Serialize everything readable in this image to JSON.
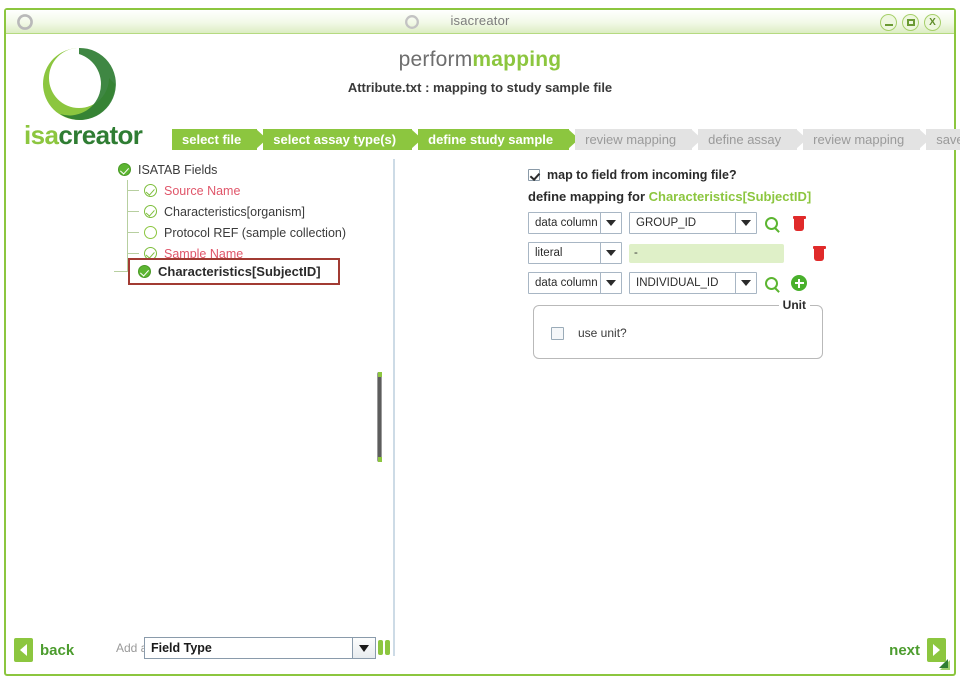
{
  "window": {
    "title": "isacreator",
    "controls": {
      "minimize": "minimize-button",
      "maximize": "maximize-button",
      "close": "X"
    }
  },
  "brand": {
    "logo_icon": "isacreator-ring-logo",
    "word_first": "isa",
    "word_second": "creator"
  },
  "header": {
    "title_prefix": "perform",
    "title_suffix": "mapping",
    "subtitle": "Attribute.txt : mapping to study sample file"
  },
  "breadcrumb": {
    "steps": [
      {
        "label": "select file",
        "state": "active"
      },
      {
        "label": "select assay type(s)",
        "state": "active"
      },
      {
        "label": "define study sample",
        "state": "active"
      },
      {
        "label": "review mapping",
        "state": "inactive"
      },
      {
        "label": "define assay",
        "state": "inactive"
      },
      {
        "label": "review mapping",
        "state": "inactive"
      },
      {
        "label": "save",
        "state": "inactive"
      }
    ]
  },
  "tree": {
    "root": {
      "label": "ISATAB Fields",
      "icon": "green-check-circle-filled"
    },
    "items": [
      {
        "label": "Source Name",
        "icon": "green-check-circle-outline",
        "style": "required"
      },
      {
        "label": "Characteristics[organism]",
        "icon": "green-check-circle-outline",
        "style": "normal"
      },
      {
        "label": "Protocol REF (sample collection)",
        "icon": "green-empty-circle",
        "style": "normal"
      },
      {
        "label": "Sample Name",
        "icon": "green-check-circle-outline",
        "style": "required"
      }
    ],
    "selected": {
      "label": "Characteristics[SubjectID]",
      "icon": "green-check-circle-filled"
    }
  },
  "mapping": {
    "map_checkbox": {
      "label": "map to field from incoming file?",
      "checked": true
    },
    "define_prefix": "define mapping for",
    "define_target": "Characteristics[SubjectID]",
    "rows": [
      {
        "type": "data column",
        "value": "GROUP_ID",
        "has_value_dropdown": true,
        "search_icon": "magnifier-icon",
        "action_icon": "trash-icon"
      },
      {
        "type": "literal",
        "value": "-",
        "has_value_dropdown": false,
        "search_icon": "",
        "action_icon": "trash-icon"
      },
      {
        "type": "data column",
        "value": "INDIVIDUAL_ID",
        "has_value_dropdown": true,
        "search_icon": "magnifier-icon",
        "action_icon": "plus-icon"
      }
    ]
  },
  "unit_group": {
    "title": "Unit",
    "checkbox_label": "use unit?",
    "checked": false
  },
  "add_field": {
    "label": "Add a",
    "value": "Field Type"
  },
  "nav": {
    "back": "back",
    "next": "next"
  },
  "colors": {
    "brand_green": "#8cc63f",
    "dark_green": "#2f7d33",
    "required_red": "#e0566a",
    "selection_border": "#a23b33",
    "literal_field_bg": "#dff0c8",
    "inactive_crumb": "#e3e3e3"
  }
}
